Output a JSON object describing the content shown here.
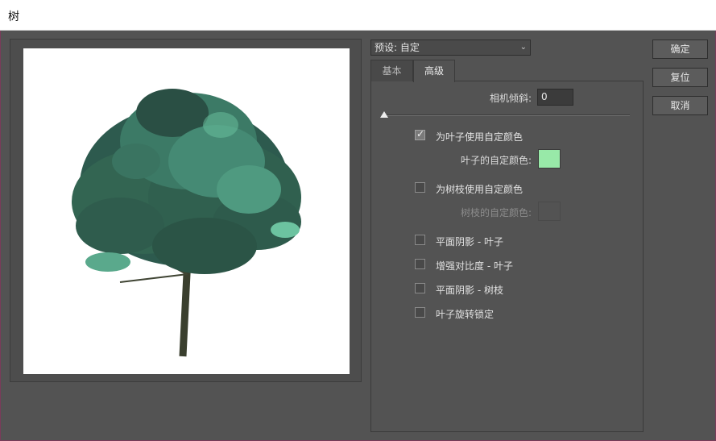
{
  "window": {
    "title": "树"
  },
  "preset": {
    "label": "预设: 自定"
  },
  "tabs": [
    {
      "label": "基本"
    },
    {
      "label": "高级"
    }
  ],
  "camera_tilt": {
    "label": "相机倾斜:",
    "value": "0",
    "slider_fraction": 0.0
  },
  "leaf_custom_color": {
    "label": "为叶子使用自定颜色",
    "checked": true,
    "color_label": "叶子的自定颜色:",
    "color": "#98e9a8"
  },
  "branch_custom_color": {
    "label": "为树枝使用自定颜色",
    "checked": false,
    "color_label": "树枝的自定颜色:",
    "color": "#535353"
  },
  "options": [
    {
      "label": "平面阴影 - 叶子",
      "checked": false
    },
    {
      "label": "增强对比度 - 叶子",
      "checked": false
    },
    {
      "label": "平面阴影 - 树枝",
      "checked": false
    },
    {
      "label": "叶子旋转锁定",
      "checked": false
    }
  ],
  "buttons": {
    "ok": "确定",
    "reset": "复位",
    "cancel": "取消"
  },
  "colors": {
    "leaf_dark": "#2d5a4e",
    "leaf_mid": "#3c7a66",
    "leaf_light": "#6cc3a0",
    "trunk": "#3a3f2e"
  }
}
